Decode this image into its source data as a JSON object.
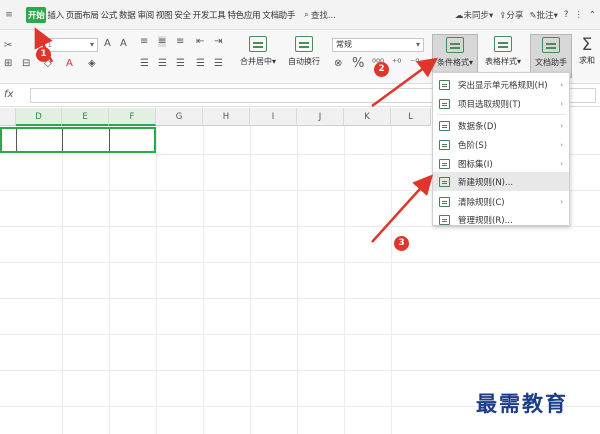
{
  "menubar": {
    "qa_icon": "≡",
    "tabs": [
      "开始",
      "插入",
      "页面布局",
      "公式",
      "数据",
      "审阅",
      "视图",
      "安全",
      "开发工具",
      "特色应用",
      "文档助手"
    ],
    "search_label": "查找...",
    "sync_label": "未同步",
    "share_label": "分享",
    "comment_label": "批注",
    "help_icon": "?"
  },
  "ribbon": {
    "font_size": "11",
    "merge_label": "合并居中",
    "wrap_label": "自动换行",
    "number_format": "常规",
    "percent": "%",
    "cond_format_label": "条件格式",
    "table_style_label": "表格样式",
    "doc_assistant_label": "文档助手",
    "sum_label": "求和",
    "fx_label": "fx"
  },
  "sheet": {
    "columns": [
      "D",
      "E",
      "F",
      "G",
      "H",
      "I",
      "J",
      "K",
      "L"
    ]
  },
  "dropdown": {
    "items": [
      {
        "label": "突出显示单元格规则(H)",
        "submenu": true
      },
      {
        "label": "项目选取规则(T)",
        "submenu": true
      },
      {
        "label": "数据条(D)",
        "submenu": true
      },
      {
        "label": "色阶(S)",
        "submenu": true
      },
      {
        "label": "图标集(I)",
        "submenu": true
      },
      {
        "label": "新建规则(N)...",
        "submenu": false
      },
      {
        "label": "清除规则(C)",
        "submenu": true
      },
      {
        "label": "管理规则(R)...",
        "submenu": false
      }
    ]
  },
  "annotations": {
    "badge1": "1",
    "badge2": "2",
    "badge3": "3"
  },
  "watermark": "最需教育",
  "colors": {
    "accent": "#2aa84a",
    "arrow": "#e0352b",
    "watermark": "#1c3d8a"
  }
}
